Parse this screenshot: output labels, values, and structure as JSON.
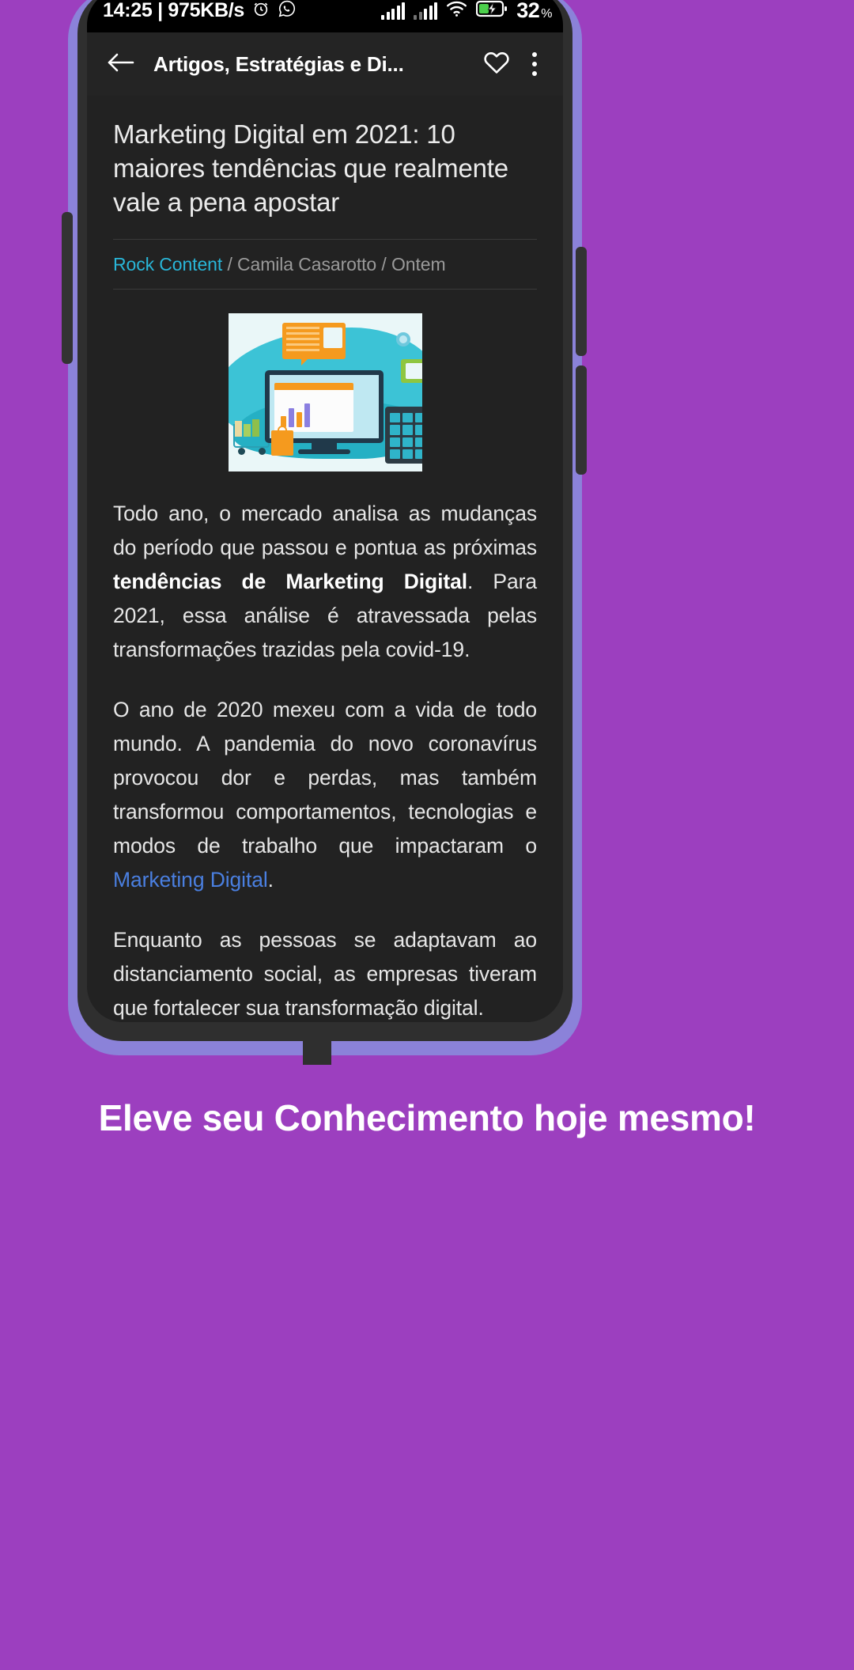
{
  "status_bar": {
    "time_and_network": "14:25 | 975KB/s",
    "alarm_icon": "alarm-clock-icon",
    "whatsapp_icon": "whatsapp-icon",
    "signal_1_icon": "cellular-signal-icon",
    "signal_2_icon": "cellular-signal-icon",
    "wifi_icon": "wifi-icon",
    "battery_icon": "battery-charging-icon",
    "battery_level": "32",
    "battery_unit": "%"
  },
  "app_bar": {
    "back_icon": "back-arrow-icon",
    "title": "Artigos, Estratégias e Di...",
    "favorite_icon": "heart-outline-icon",
    "overflow_icon": "three-dot-menu-icon"
  },
  "article": {
    "title": "Marketing Digital em 2021: 10 maiores tendências que realmente vale a pena apostar",
    "byline": {
      "source": "Rock Content",
      "separator_1": " / ",
      "author": "Camila Casarotto",
      "separator_2": " / ",
      "date": "Ontem"
    },
    "figure_alt": "digital-marketing-illustration",
    "paragraphs": [
      {
        "id": "p1",
        "segments": [
          {
            "text": "Todo ano, o mercado analisa as mudanças do período que passou e pontua as próximas ",
            "style": "normal"
          },
          {
            "text": "tendências de Marketing Digital",
            "style": "bold"
          },
          {
            "text": ". Para 2021, essa análise é atravessada pelas transformações trazidas pela covid-19.",
            "style": "normal"
          }
        ]
      },
      {
        "id": "p2",
        "segments": [
          {
            "text": "O ano de 2020 mexeu com a vida de todo mundo. A pandemia do novo coronavírus provocou dor e perdas, mas também transformou comportamentos, tecnologias e modos de trabalho que impactaram o ",
            "style": "normal"
          },
          {
            "text": "Marketing Digital",
            "style": "link"
          },
          {
            "text": ".",
            "style": "normal"
          }
        ]
      },
      {
        "id": "p3",
        "segments": [
          {
            "text": "Enquanto as pessoas se adaptavam ao distanciamento social, as empresas tiveram que fortalecer sua transformação digital.",
            "style": "normal"
          }
        ]
      }
    ]
  },
  "bottom_caption": "Eleve seu Conhecimento hoje mesmo!",
  "colors": {
    "background_purple": "#9c3fbf",
    "phone_frame": "#8b82d9",
    "phone_bezel": "#2f2f2f",
    "app_background": "#222222",
    "app_bar": "#242424",
    "source_cyan": "#29b6d8",
    "link_blue": "#4a7fe0",
    "battery_green": "#4cd04c",
    "caption_white": "#ffffff"
  }
}
